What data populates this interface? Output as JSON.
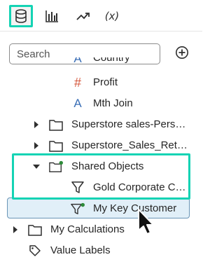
{
  "tabs": [
    {
      "name": "data",
      "icon": "database-icon",
      "active": true
    },
    {
      "name": "visualizations",
      "icon": "bar-chart-icon",
      "active": false
    },
    {
      "name": "analytics",
      "icon": "trend-arrow-icon",
      "active": false
    },
    {
      "name": "calculations",
      "icon": "fx-icon",
      "label": "(x)",
      "active": false
    }
  ],
  "search": {
    "placeholder": "Search",
    "value": ""
  },
  "add_button": {
    "icon": "plus-circle-icon"
  },
  "tree": {
    "items": [
      {
        "label": "Country",
        "icon": "text-attribute-icon"
      },
      {
        "label": "Profit",
        "icon": "hash-measure-icon"
      },
      {
        "label": "Mth Join",
        "icon": "text-attribute-icon"
      },
      {
        "label": "Superstore sales-Pers…",
        "icon": "folder-icon",
        "expanded": false
      },
      {
        "label": "Superstore_Sales_Ret…",
        "icon": "folder-icon",
        "expanded": false
      },
      {
        "label": "Shared Objects",
        "icon": "folder-shared-icon",
        "expanded": true
      },
      {
        "label": "Gold Corporate C…",
        "icon": "filter-icon"
      },
      {
        "label": "My Key Customer",
        "icon": "filter-shared-icon",
        "selected": true
      },
      {
        "label": "My Calculations",
        "icon": "folder-icon",
        "expanded": false
      },
      {
        "label": "Value Labels",
        "icon": "tag-icon"
      }
    ]
  },
  "colors": {
    "highlight": "#14d3b4",
    "selection_bg": "#e1eff8",
    "selection_border": "#6a95b6",
    "measure_hash": "#d4573c",
    "attribute_a": "#3b6fb6",
    "shared_dot": "#2e8b3a"
  }
}
